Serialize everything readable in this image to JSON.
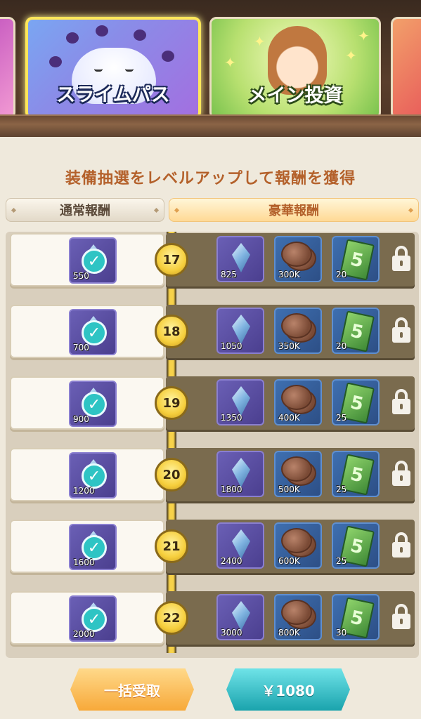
{
  "banners": [
    {
      "id": "left-edge",
      "label": ""
    },
    {
      "id": "slime-pass",
      "label": "スライムパス",
      "active": true
    },
    {
      "id": "main-invest",
      "label": "メイン投資",
      "active": false
    },
    {
      "id": "right-edge",
      "label": ""
    }
  ],
  "subtitle": "装備抽選をレベルアップして報酬を獲得",
  "tabs": {
    "normal": "通常報酬",
    "deluxe": "豪華報酬"
  },
  "rows": [
    {
      "level": "17",
      "free_qty": "550",
      "free_claimed": true,
      "premium": [
        "825",
        "300K",
        "20"
      ],
      "locked": true
    },
    {
      "level": "18",
      "free_qty": "700",
      "free_claimed": true,
      "premium": [
        "1050",
        "350K",
        "20"
      ],
      "locked": true
    },
    {
      "level": "19",
      "free_qty": "900",
      "free_claimed": true,
      "premium": [
        "1350",
        "400K",
        "25"
      ],
      "locked": true
    },
    {
      "level": "20",
      "free_qty": "1200",
      "free_claimed": true,
      "premium": [
        "1800",
        "500K",
        "25"
      ],
      "locked": true
    },
    {
      "level": "21",
      "free_qty": "1600",
      "free_claimed": true,
      "premium": [
        "2400",
        "600K",
        "25"
      ],
      "locked": true
    },
    {
      "level": "22",
      "free_qty": "2000",
      "free_claimed": true,
      "premium": [
        "3000",
        "800K",
        "30"
      ],
      "locked": true
    }
  ],
  "buttons": {
    "claim_all": "一括受取",
    "purchase": "￥1080"
  },
  "colors": {
    "accent_orange": "#f7a93a",
    "accent_teal": "#1aa3ad",
    "spine_gold": "#f7d24a",
    "premium_bg": "#7a6b4e"
  }
}
